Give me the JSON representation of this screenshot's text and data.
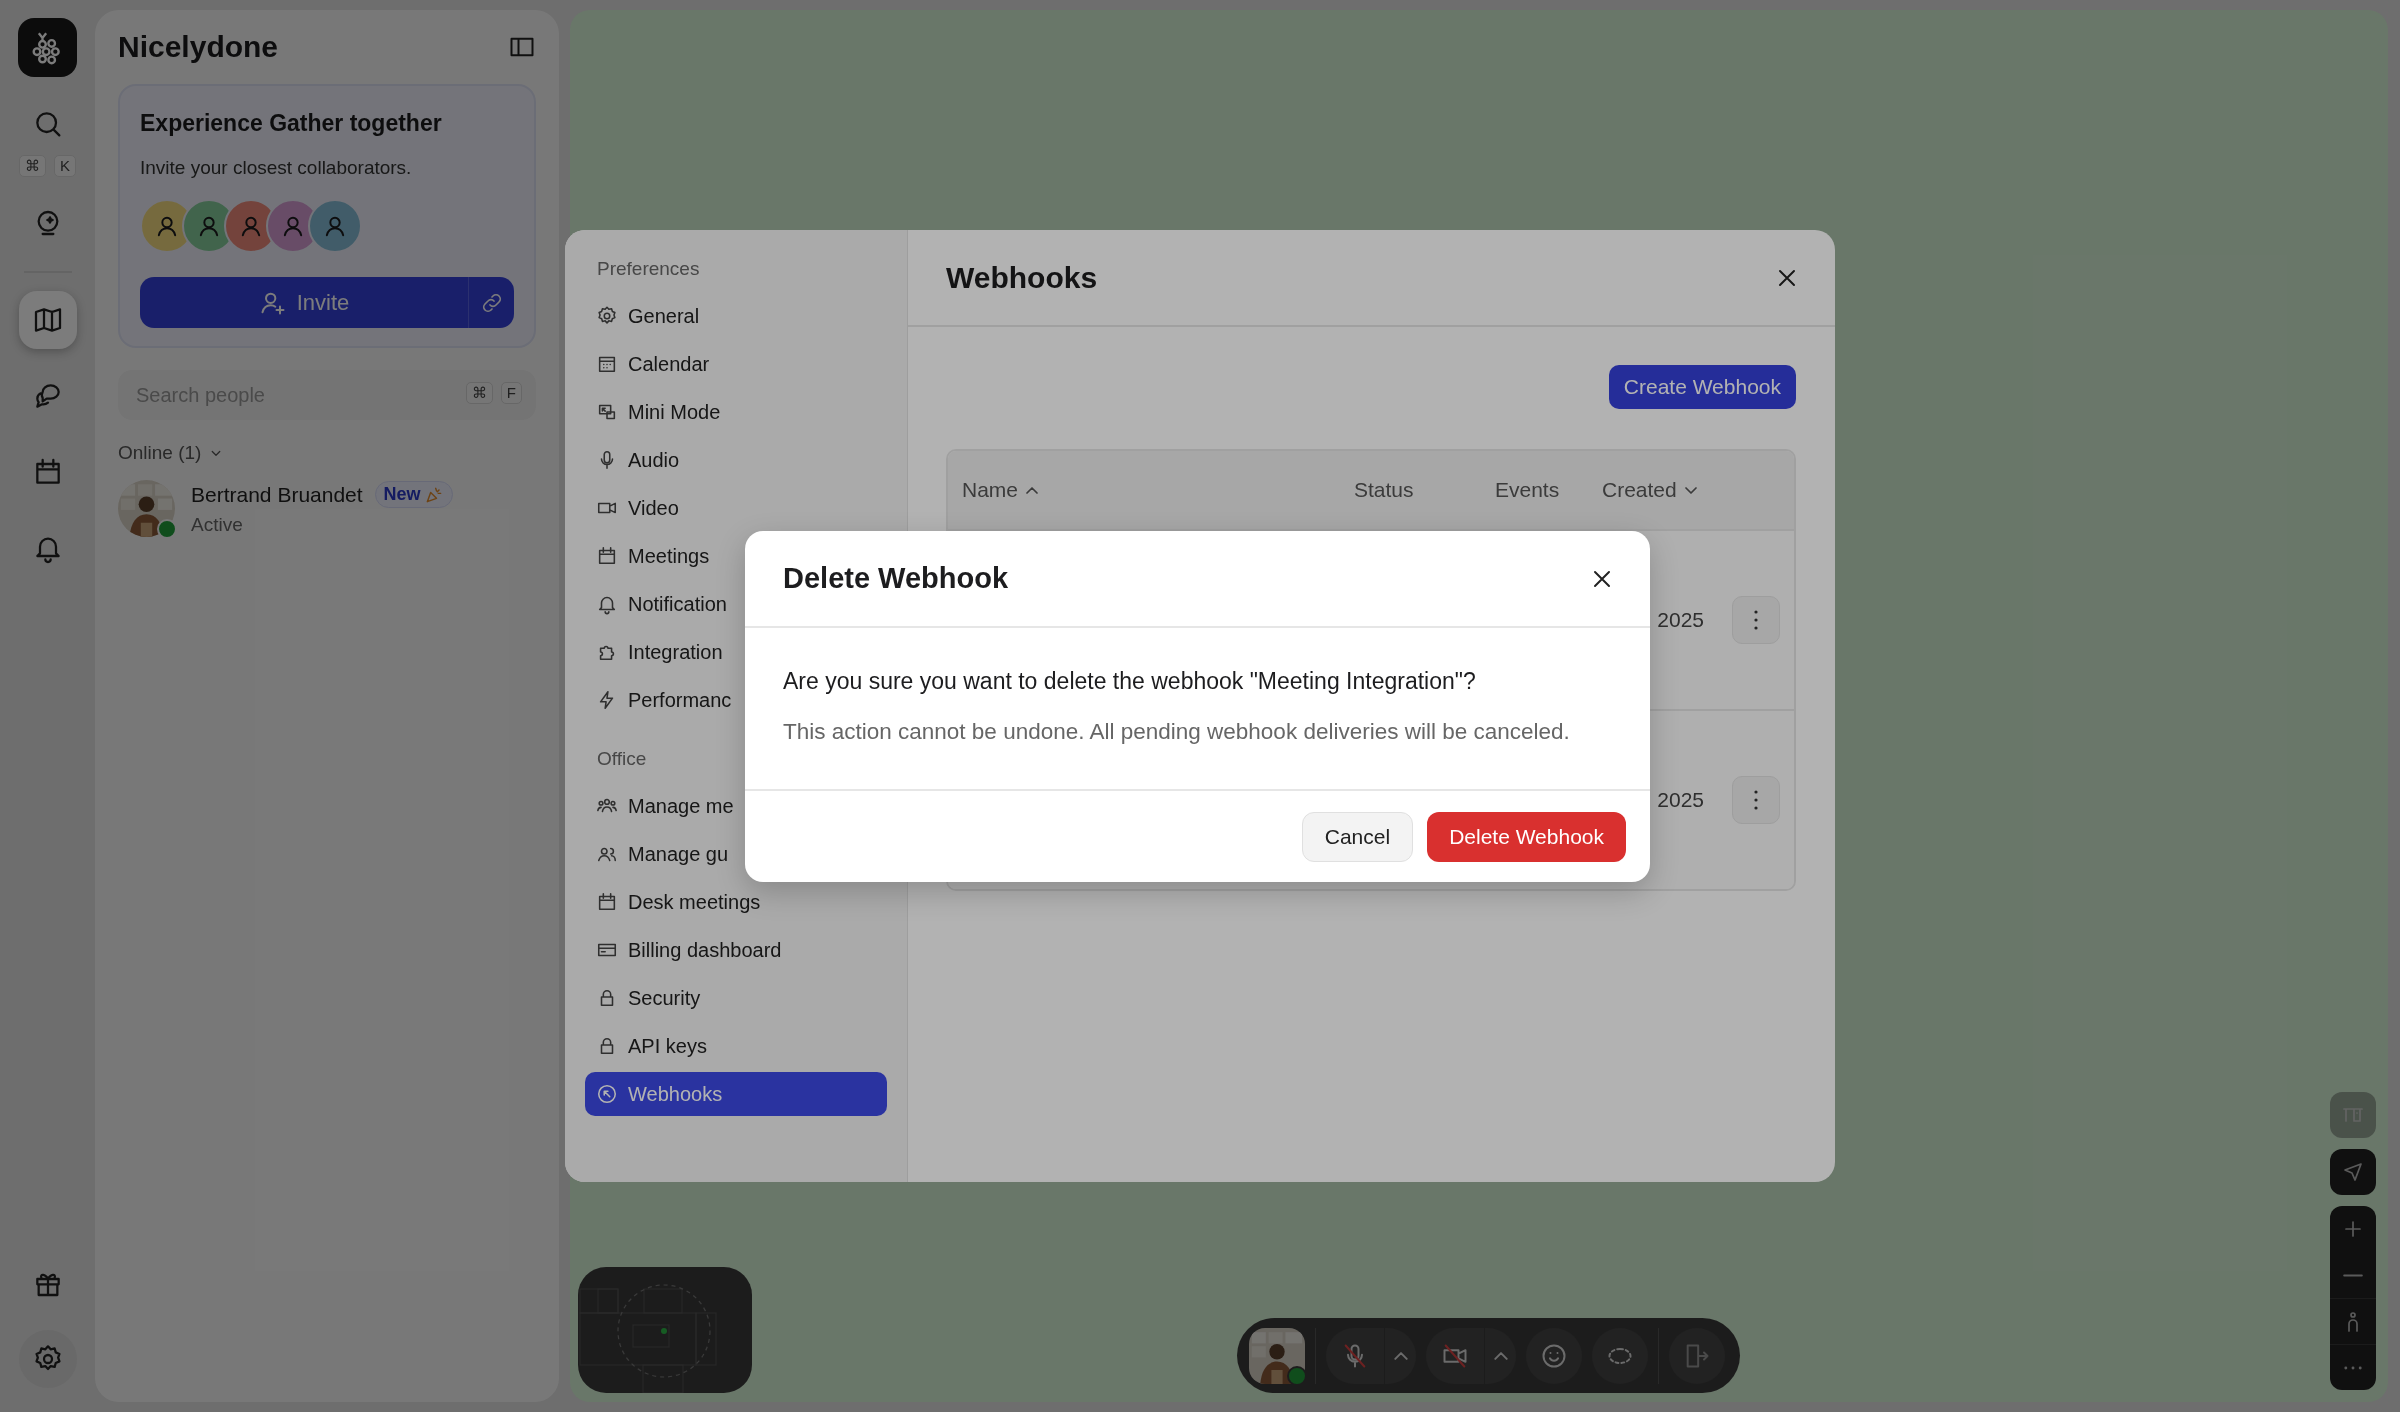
{
  "rail": {
    "items": [
      {
        "kind": "search",
        "selected": false,
        "shortcut": [
          "⌘",
          "K"
        ]
      },
      {
        "kind": "assistant",
        "selected": false
      },
      {
        "kind": "map",
        "selected": true
      },
      {
        "kind": "chat",
        "selected": false
      },
      {
        "kind": "calendar",
        "selected": false
      },
      {
        "kind": "notifications",
        "selected": false
      }
    ]
  },
  "sidebar": {
    "title": "Nicelydone",
    "promo": {
      "title": "Experience Gather together",
      "text": "Invite your closest collaborators.",
      "invite_button": "Invite"
    },
    "search": {
      "placeholder": "Search people",
      "shortcut": [
        "⌘",
        "F"
      ]
    },
    "online": {
      "label": "Online (1)",
      "expanded": true,
      "people": [
        {
          "name": "Bertrand Bruandet",
          "badge": "New",
          "status": "Active",
          "online": true
        }
      ]
    }
  },
  "settings": {
    "sections": [
      {
        "title": "Preferences",
        "items": [
          {
            "kind": "general",
            "label": "General",
            "selected": false
          },
          {
            "kind": "calendar",
            "label": "Calendar",
            "selected": false
          },
          {
            "kind": "mini_mode",
            "label": "Mini Mode",
            "selected": false
          },
          {
            "kind": "audio",
            "label": "Audio",
            "selected": false
          },
          {
            "kind": "video",
            "label": "Video",
            "selected": false
          },
          {
            "kind": "meetings",
            "label": "Meetings",
            "selected": false
          },
          {
            "kind": "notifications",
            "label": "Notification",
            "selected": false
          },
          {
            "kind": "integrations",
            "label": "Integration",
            "selected": false
          },
          {
            "kind": "performance",
            "label": "Performanc",
            "selected": false
          }
        ]
      },
      {
        "title": "Office",
        "items": [
          {
            "kind": "members",
            "label": "Manage me",
            "selected": false
          },
          {
            "kind": "guests",
            "label": "Manage gu",
            "selected": false
          },
          {
            "kind": "desk_meetings",
            "label": "Desk meetings",
            "selected": false
          },
          {
            "kind": "billing",
            "label": "Billing dashboard",
            "selected": false
          },
          {
            "kind": "security",
            "label": "Security",
            "selected": false
          },
          {
            "kind": "api_keys",
            "label": "API keys",
            "selected": false
          },
          {
            "kind": "webhooks",
            "label": "Webhooks",
            "selected": true
          }
        ]
      }
    ]
  },
  "webhooks": {
    "title": "Webhooks",
    "create_button": "Create Webhook",
    "table": {
      "columns": [
        {
          "label": "Name",
          "sorted": true,
          "descending": false
        },
        {
          "label": "Status"
        },
        {
          "label": "Events"
        },
        {
          "label": "Created",
          "sorted": true,
          "descending": true
        }
      ],
      "rows": [
        {
          "created": "2025"
        },
        {
          "created": "2025"
        }
      ]
    }
  },
  "dialog": {
    "title": "Delete Webhook",
    "question": "Are you sure you want to delete the webhook \"Meeting Integration\"?",
    "note": "This action cannot be undone. All pending webhook deliveries will be canceled.",
    "buttons": [
      {
        "label": "Cancel",
        "kind": "secondary"
      },
      {
        "label": "Delete Webhook",
        "kind": "danger"
      }
    ]
  },
  "call_bar": {
    "online": true,
    "mic_on": false,
    "camera_on": false
  }
}
